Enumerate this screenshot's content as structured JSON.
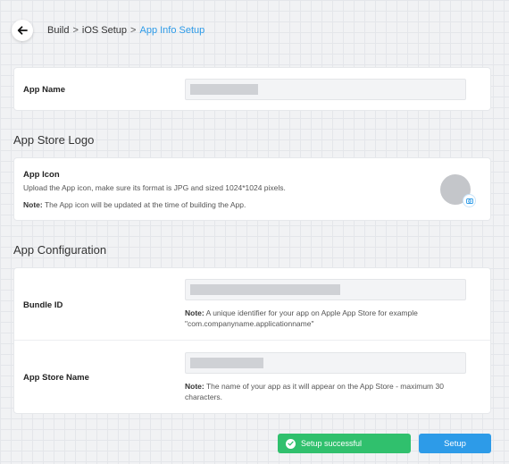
{
  "breadcrumb": {
    "items": [
      "Build",
      "iOS Setup",
      "App Info Setup"
    ],
    "separator": ">"
  },
  "app_name": {
    "label": "App Name"
  },
  "logo_section": {
    "title": "App Store Logo",
    "icon_label": "App Icon",
    "icon_desc": "Upload the App icon, make sure its format is JPG and sized 1024*1024 pixels.",
    "note_prefix": "Note:",
    "note_text": " The App icon will be updated at the time of building the App."
  },
  "config_section": {
    "title": "App Configuration",
    "bundle_label": "Bundle ID",
    "bundle_note_prefix": "Note:",
    "bundle_note_text": " A unique identifier for your app on Apple App Store for example \"com.companyname.applicationname\"",
    "store_label": "App Store Name",
    "store_note_prefix": "Note:",
    "store_note_text": " The name of your app as it will appear on the App Store - maximum 30 characters."
  },
  "toast": {
    "text": "Setup successful",
    "color": "#30c06d"
  },
  "actions": {
    "setup_label": "Setup",
    "accent": "#2d9be8"
  },
  "icons": [
    "arrow-left-icon",
    "check-circle-icon",
    "camera-icon"
  ]
}
